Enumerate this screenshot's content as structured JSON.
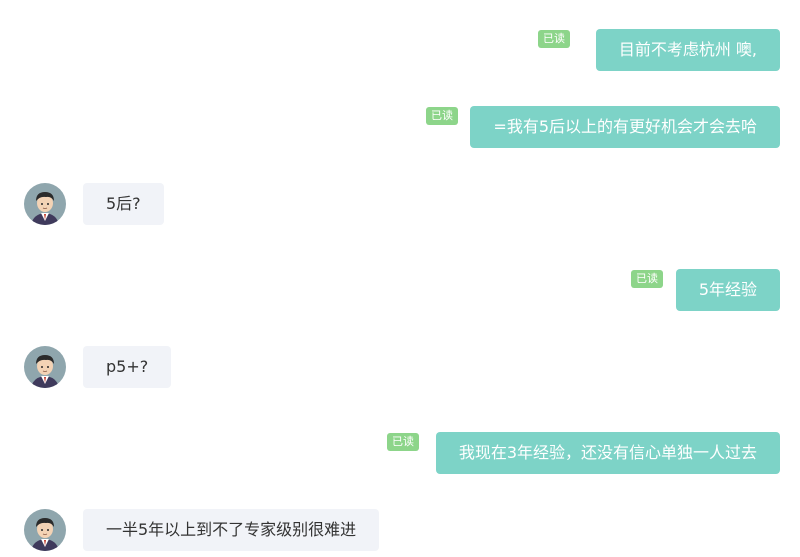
{
  "read_label": "已读",
  "messages": [
    {
      "direction": "outgoing",
      "text": "目前不考虑杭州 噢,"
    },
    {
      "direction": "outgoing",
      "text": "=我有5后以上的有更好机会才会去哈"
    },
    {
      "direction": "incoming",
      "text": "5后?"
    },
    {
      "direction": "outgoing",
      "text": "5年经验"
    },
    {
      "direction": "incoming",
      "text": "p5+?"
    },
    {
      "direction": "outgoing",
      "text": "我现在3年经验，还没有信心单独一人过去"
    },
    {
      "direction": "incoming",
      "text": "一半5年以上到不了专家级别很难进"
    }
  ],
  "colors": {
    "outgoing_bubble": "#7dd3c7",
    "incoming_bubble": "#f1f3f8",
    "read_badge": "#8dd58a"
  },
  "icons": {
    "avatar": "cartoon-man-avatar-icon"
  }
}
